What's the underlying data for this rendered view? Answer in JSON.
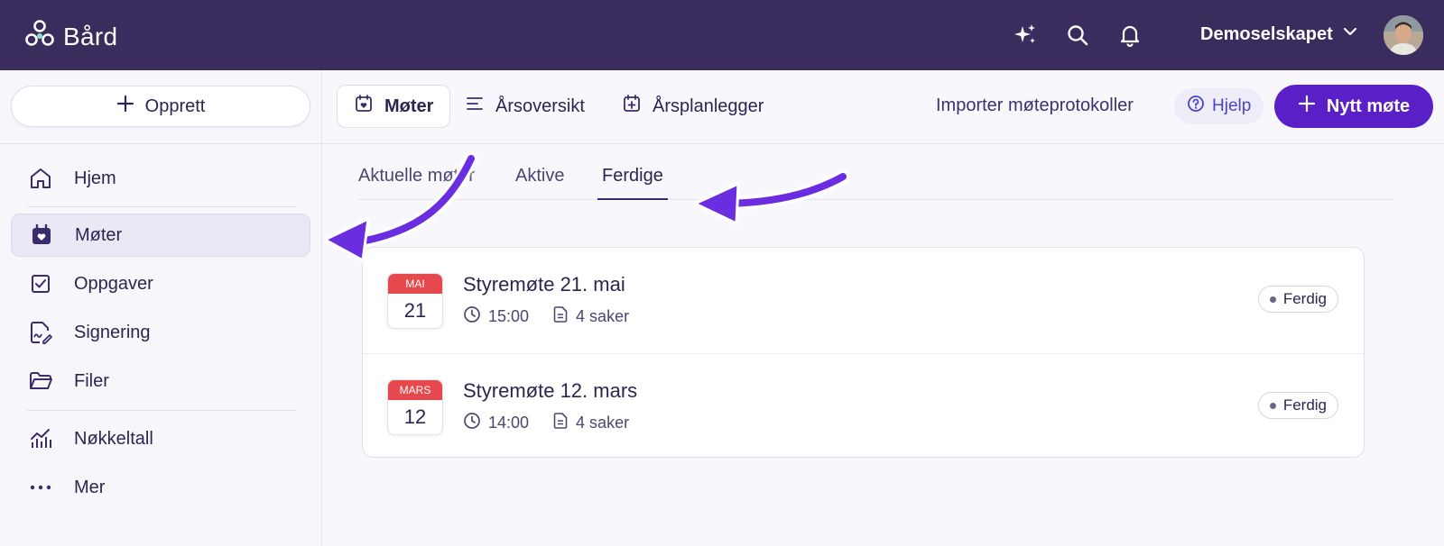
{
  "app": {
    "name": "Bård"
  },
  "header": {
    "company": "Demoselskapet"
  },
  "sidebar": {
    "create_label": "Opprett",
    "items": [
      {
        "label": "Hjem",
        "icon": "home-icon"
      },
      {
        "label": "Møter",
        "icon": "calendar-heart-icon",
        "active": true
      },
      {
        "label": "Oppgaver",
        "icon": "checkbox-icon"
      },
      {
        "label": "Signering",
        "icon": "signature-icon"
      },
      {
        "label": "Filer",
        "icon": "folder-icon"
      },
      {
        "label": "Nøkkeltall",
        "icon": "chart-icon"
      },
      {
        "label": "Mer",
        "icon": "more-icon"
      }
    ]
  },
  "toolbar": {
    "tabs": [
      {
        "label": "Møter",
        "active": true
      },
      {
        "label": "Årsoversikt"
      },
      {
        "label": "Årsplanlegger"
      }
    ],
    "import_label": "Importer møteprotokoller",
    "help_label": "Hjelp",
    "new_meeting_label": "Nytt møte"
  },
  "subtabs": [
    {
      "label": "Aktuelle møter"
    },
    {
      "label": "Aktive"
    },
    {
      "label": "Ferdige",
      "active": true
    }
  ],
  "meetings": [
    {
      "month": "MAI",
      "day": "21",
      "title": "Styremøte 21. mai",
      "time": "15:00",
      "items": "4 saker",
      "status": "Ferdig"
    },
    {
      "month": "MARS",
      "day": "12",
      "title": "Styremøte 12. mars",
      "time": "14:00",
      "items": "4 saker",
      "status": "Ferdig"
    }
  ],
  "colors": {
    "header": "#3a2c5c",
    "accent": "#5b1fc7",
    "calendar_red": "#e5484d",
    "arrow": "#6a2ee0"
  }
}
